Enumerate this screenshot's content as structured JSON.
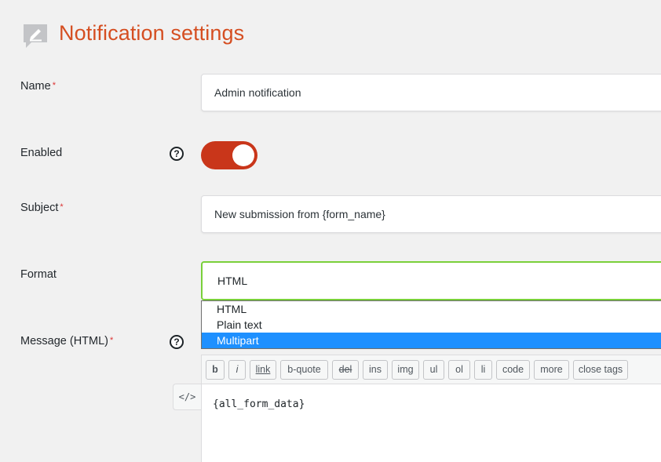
{
  "header": {
    "title": "Notification settings",
    "icon": "notification-edit-icon"
  },
  "colors": {
    "accent": "#d54e21",
    "toggle_on": "#c9361a",
    "focus_border": "#7ad03a",
    "selection": "#1e90ff",
    "required": "#dc3232"
  },
  "form": {
    "name": {
      "label": "Name",
      "required_mark": "*",
      "value": "Admin notification"
    },
    "enabled": {
      "label": "Enabled",
      "help_icon": "?",
      "checked": true
    },
    "subject": {
      "label": "Subject",
      "required_mark": "*",
      "value": "New submission from {form_name}"
    },
    "format": {
      "label": "Format",
      "selected": "HTML",
      "options": [
        "HTML",
        "Plain text",
        "Multipart"
      ],
      "highlighted_option": "Multipart"
    },
    "message": {
      "label": "Message (HTML)",
      "required_mark": "*",
      "help_icon": "?",
      "code_toggle": "</>",
      "quicktags": [
        "b",
        "i",
        "link",
        "b-quote",
        "del",
        "ins",
        "img",
        "ul",
        "ol",
        "li",
        "code",
        "more",
        "close tags"
      ],
      "content": "{all_form_data}"
    }
  }
}
